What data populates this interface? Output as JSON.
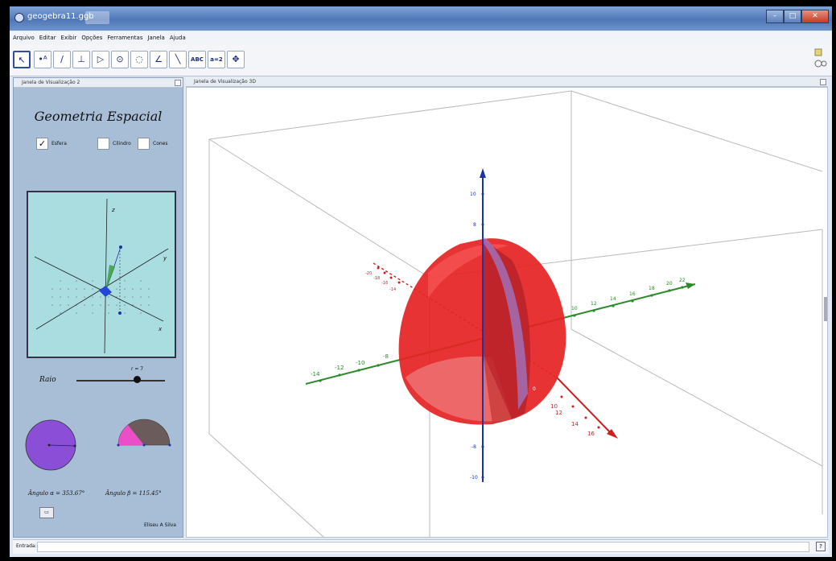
{
  "window": {
    "title": "geogebra11.ggb",
    "min_label": "–",
    "max_label": "□",
    "close_label": "✕"
  },
  "menu": [
    "Arquivo",
    "Editar",
    "Exibir",
    "Opções",
    "Ferramentas",
    "Janela",
    "Ajuda"
  ],
  "toolbar": {
    "tools": [
      {
        "name": "move-tool",
        "glyph": "↖"
      },
      {
        "name": "point-tool",
        "glyph": "•ᴬ"
      },
      {
        "name": "line-tool",
        "glyph": "∕"
      },
      {
        "name": "perpendicular-tool",
        "glyph": "⊥"
      },
      {
        "name": "polygon-tool",
        "glyph": "▷"
      },
      {
        "name": "circle-tool",
        "glyph": "⊙"
      },
      {
        "name": "circle-three-point-tool",
        "glyph": "◌"
      },
      {
        "name": "angle-tool",
        "glyph": "∠"
      },
      {
        "name": "reflect-tool",
        "glyph": "╲"
      },
      {
        "name": "text-tool",
        "glyph": "ABC"
      },
      {
        "name": "slider-tool",
        "glyph": "a=2"
      },
      {
        "name": "move-view-tool",
        "glyph": "✥"
      }
    ]
  },
  "left_panel": {
    "header": "Janela de Visualização 2",
    "title": "Geometria Espacial",
    "checkboxes": [
      {
        "label": "Esfera",
        "checked": true,
        "mark": "✓"
      },
      {
        "label": "Cilindro",
        "checked": false,
        "mark": ""
      },
      {
        "label": "Cones",
        "checked": false,
        "mark": ""
      }
    ],
    "mini_axes": {
      "x": "x",
      "y": "y",
      "z": "z"
    },
    "slider_label": "Raio",
    "slider_value_text": "r = 7",
    "slider_fraction": 0.68,
    "angle_alpha": "Ângulo α = 353.67°",
    "angle_beta": "Ângulo β = 115.45°",
    "small_button": "▭",
    "author": "Eliseu A Silva"
  },
  "right_panel": {
    "header": "Janela de Visualização 3D"
  },
  "axes3d": {
    "z_ticks": [
      "10",
      "8",
      "-8",
      "-10"
    ],
    "y_ticks_neg": [
      "-14",
      "-12",
      "-10",
      "-8"
    ],
    "y_ticks_pos": [
      "10",
      "12",
      "14",
      "16",
      "18",
      "20",
      "22"
    ],
    "x_ticks_neg": [
      "-20",
      "-18",
      "-16",
      "-14"
    ],
    "x_ticks_pos": [
      "10",
      "12",
      "14",
      "16"
    ],
    "inner_tick": "0"
  },
  "input_bar": {
    "label": "Entrada:",
    "value": "",
    "help": "?"
  },
  "colors": {
    "sphere": "#e52222",
    "x_axis": "#cc2020",
    "y_axis": "#2a8a2a",
    "z_axis": "#1a35a8",
    "alpha_circle": "#8a4fd6",
    "beta_sector": "#6b5b5b",
    "beta_wedge": "#ea4fc8"
  }
}
